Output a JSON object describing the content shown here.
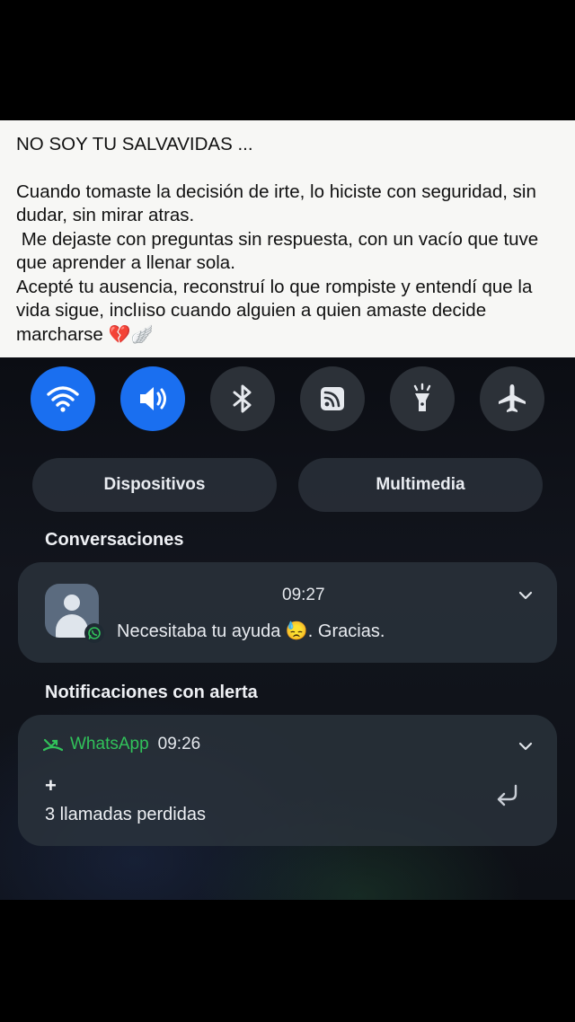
{
  "caption": {
    "title": "NO SOY TU SALVAVIDAS ...",
    "paragraph1": "Cuando tomaste la decisión de irte, lo hiciste con seguridad, sin dudar, sin mirar atras.",
    "paragraph2": " Me dejaste con preguntas sin respuesta, con un vacío que tuve que aprender a llenar sola.",
    "paragraph3": "Acepté tu ausencia, reconstruí lo que rompiste y entendí que la vida sigue, inclıiso cuando alguien a quien amaste decide marcharse",
    "emoji": "💔🪽"
  },
  "quick_settings": {
    "buttons": [
      {
        "name": "wifi-icon",
        "active": true
      },
      {
        "name": "sound-icon",
        "active": true
      },
      {
        "name": "bluetooth-icon",
        "active": false
      },
      {
        "name": "cast-icon",
        "active": false
      },
      {
        "name": "flashlight-icon",
        "active": false
      },
      {
        "name": "airplane-icon",
        "active": false
      }
    ],
    "devices_label": "Dispositivos",
    "media_label": "Multimedia"
  },
  "conversations": {
    "section_title": "Conversaciones",
    "time": "09:27",
    "message": "Necesitaba tu ayuda 😓. Gracias."
  },
  "alerts": {
    "section_title": "Notificaciones con alerta",
    "app_name": "WhatsApp",
    "time": "09:26",
    "expand_symbol": "+",
    "message": "3 llamadas perdidas"
  },
  "colors": {
    "accent": "#1a6ff0",
    "whatsapp": "#31c25a",
    "caption_bg": "#f7f7f5"
  }
}
